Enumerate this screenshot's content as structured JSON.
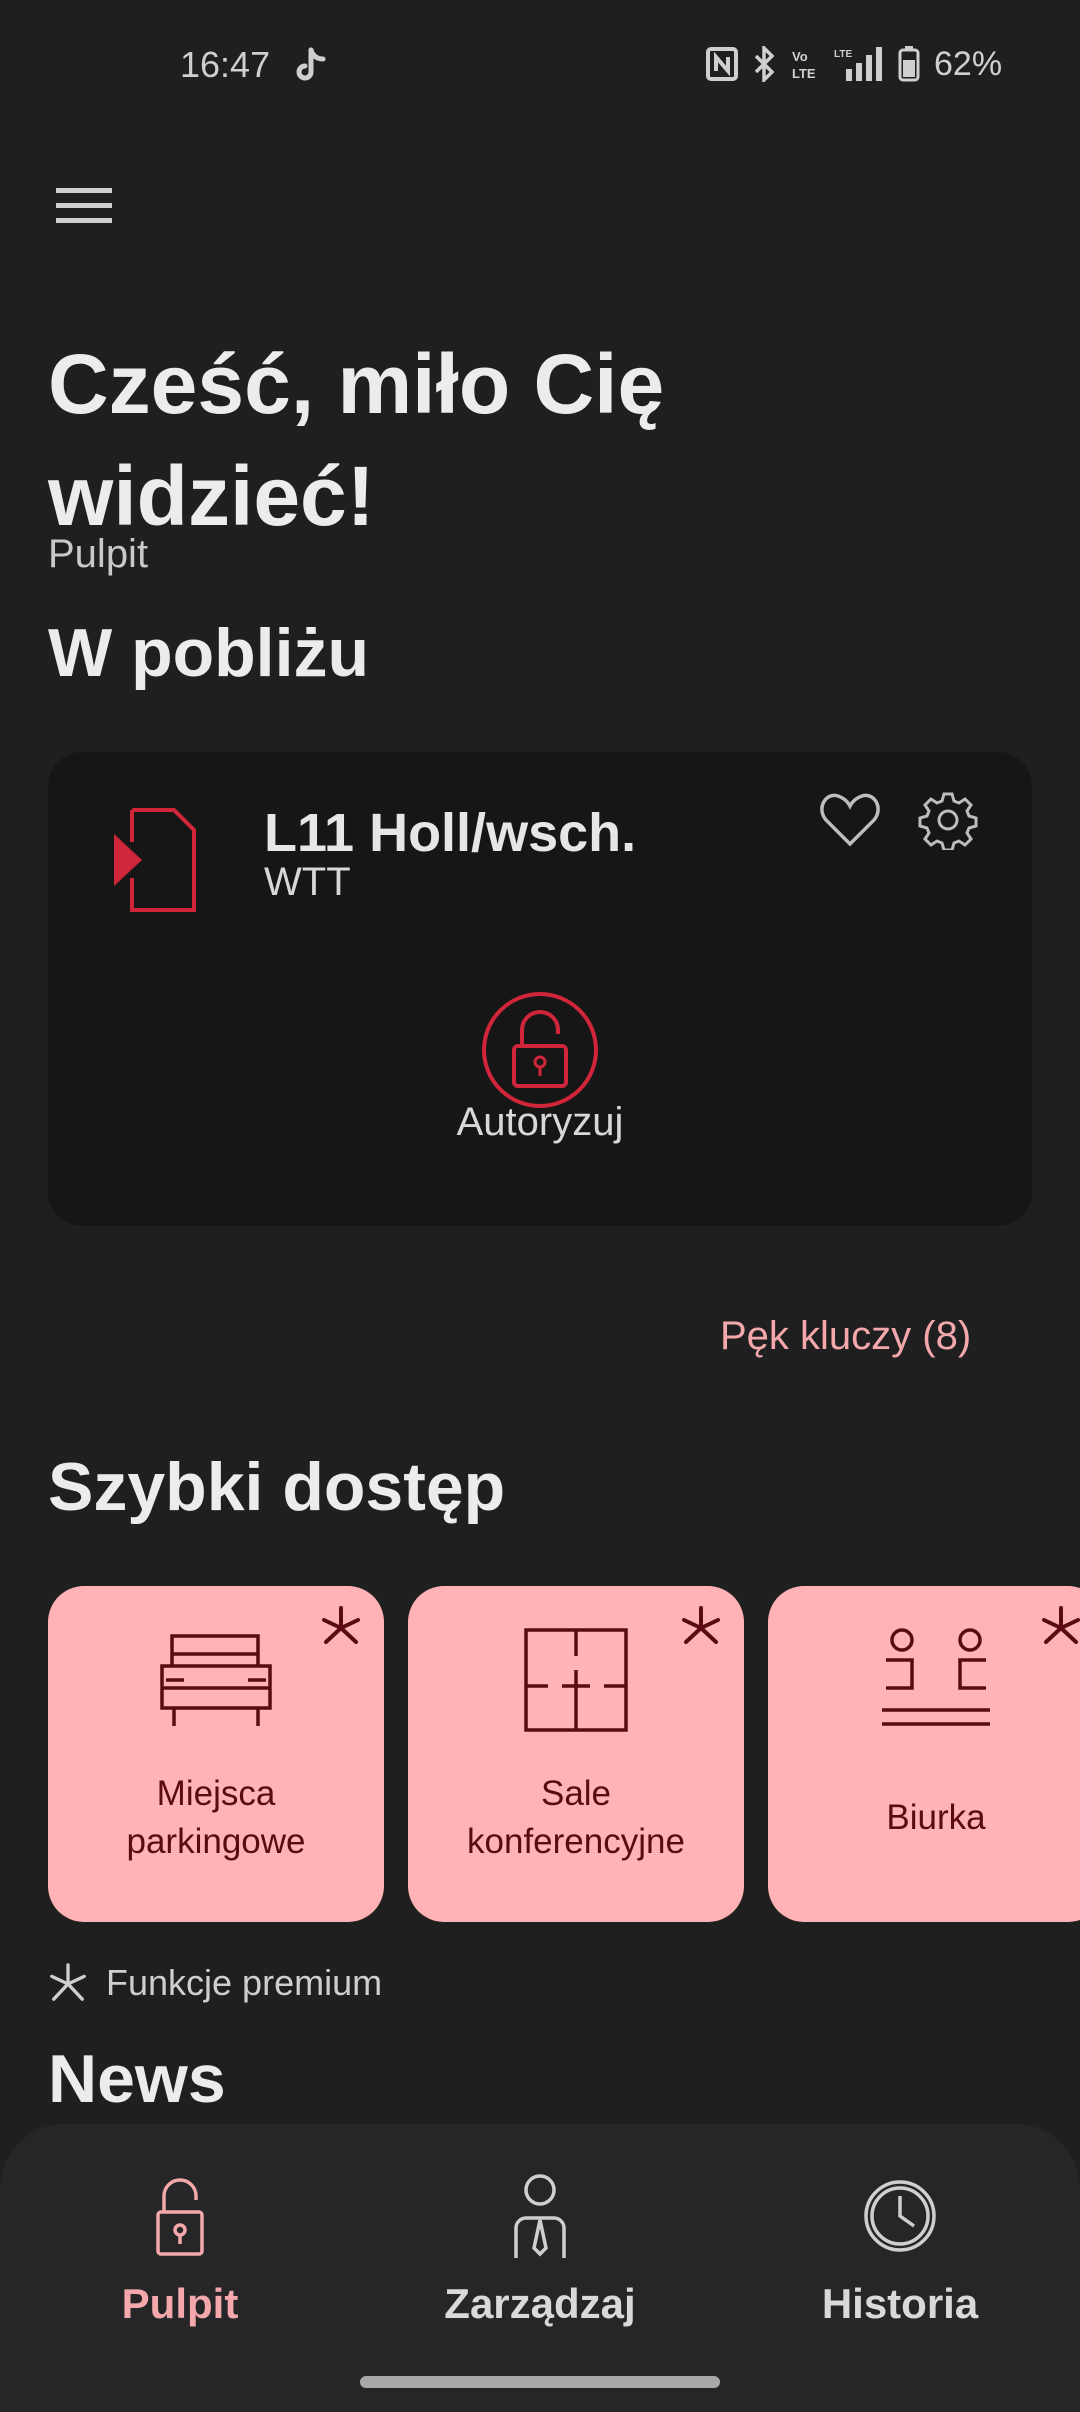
{
  "status_bar": {
    "time": "16:47",
    "battery": "62%"
  },
  "header": {
    "greeting": "Cześć, miło Cię widzieć!",
    "subtitle": "Pulpit"
  },
  "nearby": {
    "title": "W pobliżu",
    "card": {
      "title": "L11 Holl/wsch.",
      "subtitle": "WTT",
      "action_label": "Autoryzuj"
    },
    "keys_link": "Pęk kluczy (8)"
  },
  "quick_access": {
    "title": "Szybki dostęp",
    "tiles": [
      {
        "line1": "Miejsca",
        "line2": "parkingowe",
        "icon": "car-icon"
      },
      {
        "line1": "Sale",
        "line2": "konferencyjne",
        "icon": "floor-plan-icon"
      },
      {
        "line1": "Biurka",
        "line2": "",
        "icon": "desk-icon"
      }
    ],
    "premium_note": "Funkcje premium"
  },
  "news": {
    "title": "News"
  },
  "bottom_nav": {
    "items": [
      {
        "label": "Pulpit",
        "icon": "lock-icon",
        "active": true
      },
      {
        "label": "Zarządzaj",
        "icon": "person-icon",
        "active": false
      },
      {
        "label": "Historia",
        "icon": "clock-icon",
        "active": false
      }
    ]
  },
  "colors": {
    "background": "#1f1f20",
    "accent_red": "#d1263a",
    "accent_pink": "#ffb3b6",
    "tile_text": "#5b0a12",
    "link_pink": "#f4a8ab"
  }
}
